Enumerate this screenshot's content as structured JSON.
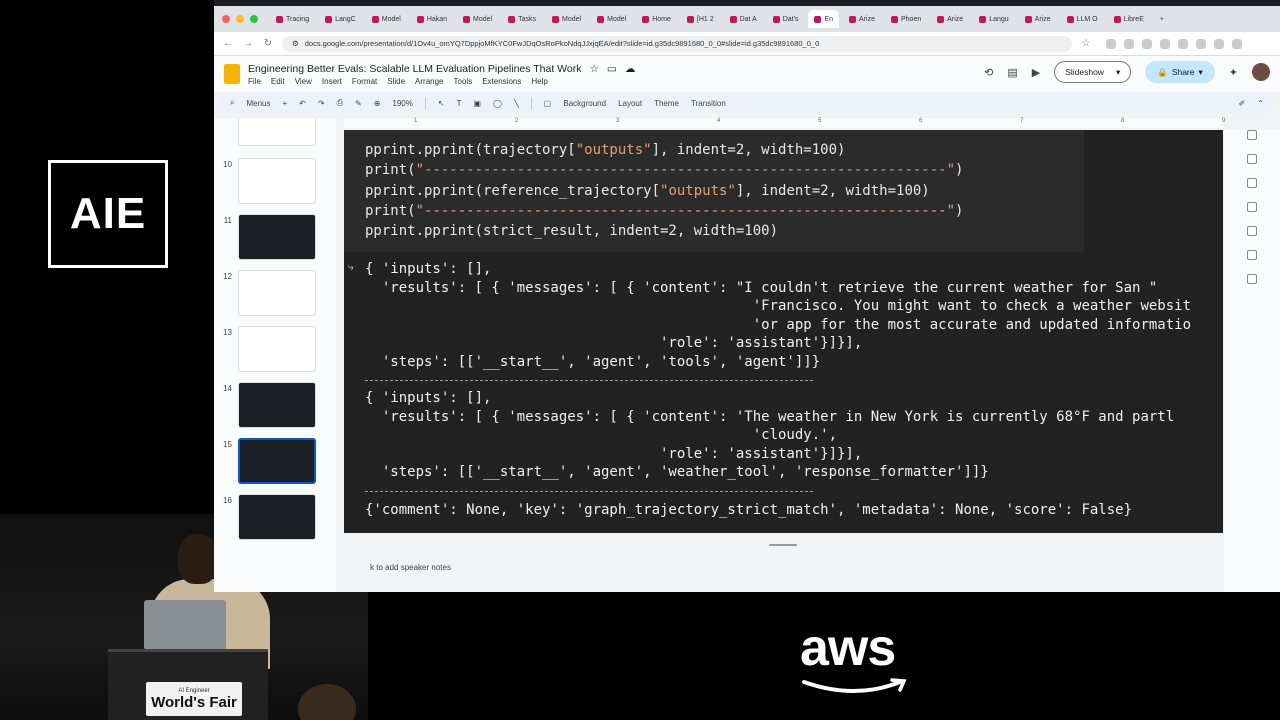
{
  "conference": {
    "logo_text": "AIE",
    "lectern_small": "AI Engineer",
    "lectern_big": "World's Fair",
    "sponsor": "aws"
  },
  "browser": {
    "tabs": [
      "Tracing",
      "LangC",
      "Model",
      "Hakan",
      "Model",
      "Tasks",
      "Model",
      "Model",
      "Home",
      "[H1 2",
      "Dat A",
      "Dat's",
      "En",
      "Arize",
      "Phoen",
      "Arize",
      "Langu",
      "Arize",
      "LLM O",
      "LibreE"
    ],
    "active_tab_index": 12,
    "url": "docs.google.com/presentation/d/1Ov4u_omYQ7DppjoMfKYC0FwJDqOsRoPkoNdqJJxjqEA/edit?slide=id.g35dc9891680_0_0#slide=id.g35dc9891680_0_0"
  },
  "doc": {
    "title": "Engineering Better Evals: Scalable LLM Evaluation Pipelines That Work",
    "menus": [
      "File",
      "Edit",
      "View",
      "Insert",
      "Format",
      "Slide",
      "Arrange",
      "Tools",
      "Extensions",
      "Help"
    ],
    "slideshow_label": "Slideshow",
    "share_label": "Share"
  },
  "toolbar": {
    "menus_label": "Menus",
    "zoom": "190%",
    "background_label": "Background",
    "layout_label": "Layout",
    "theme_label": "Theme",
    "transition_label": "Transition"
  },
  "ruler": [
    "1",
    "2",
    "3",
    "4",
    "5",
    "6",
    "7",
    "8",
    "9"
  ],
  "filmstrip": {
    "numbers": [
      "10",
      "11",
      "12",
      "13",
      "14",
      "15",
      "16"
    ],
    "selected": "15"
  },
  "slide": {
    "code": [
      {
        "pre": "pprint.pprint(trajectory[",
        "str": "\"outputs\"",
        "post": "], indent=2, width=100)"
      },
      {
        "pre": "print(",
        "str": "\"--------------------------------------------------------------\"",
        "post": ")"
      },
      {
        "pre": "pprint.pprint(reference_trajectory[",
        "str": "\"outputs\"",
        "post": "], indent=2, width=100)"
      },
      {
        "pre": "print(",
        "str": "\"--------------------------------------------------------------\"",
        "post": ")"
      },
      {
        "pre": "pprint.pprint(strict_result, indent=2, width=100)",
        "str": "",
        "post": ""
      }
    ],
    "output_block_1": [
      "{ 'inputs': [],",
      "  'results': [ { 'messages': [ { 'content': \"I couldn't retrieve the current weather for San \"",
      "                                              'Francisco. You might want to check a weather websit",
      "                                              'or app for the most accurate and updated informatio",
      "                                   'role': 'assistant'}]}],",
      "  'steps': [['__start__', 'agent', 'tools', 'agent']]}"
    ],
    "output_block_2": [
      "{ 'inputs': [],",
      "  'results': [ { 'messages': [ { 'content': 'The weather in New York is currently 68°F and partl",
      "                                              'cloudy.',",
      "                                   'role': 'assistant'}]}],",
      "  'steps': [['__start__', 'agent', 'weather_tool', 'response_formatter']]}"
    ],
    "result_line": "{'comment': None, 'key': 'graph_trajectory_strict_match', 'metadata': None, 'score': False}"
  },
  "notes": {
    "placeholder": "k to add speaker notes"
  }
}
